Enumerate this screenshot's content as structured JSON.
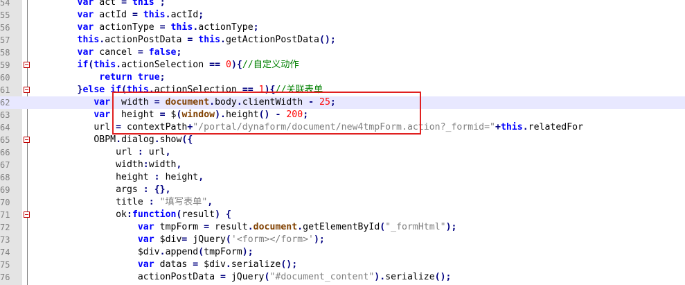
{
  "colors": {
    "keyword": "#0000ff",
    "object": "#804000",
    "string": "#808080",
    "number": "#ff0000",
    "comment": "#008000",
    "current_line": "#e8e8ff",
    "annotation_box": "#e02020"
  },
  "editor": {
    "lines": [
      {
        "num": "54",
        "fold": false,
        "indent": "        ",
        "tokens": [
          {
            "t": "keyword",
            "v": "var"
          },
          {
            "t": "plain",
            "v": " act "
          },
          {
            "t": "op",
            "v": "="
          },
          {
            "t": "plain",
            "v": " "
          },
          {
            "t": "keyword",
            "v": "this"
          },
          {
            "t": "plain",
            "v": " "
          },
          {
            "t": "op",
            "v": ";"
          }
        ]
      },
      {
        "num": "55",
        "fold": false,
        "indent": "        ",
        "tokens": [
          {
            "t": "keyword",
            "v": "var"
          },
          {
            "t": "plain",
            "v": " actId "
          },
          {
            "t": "op",
            "v": "="
          },
          {
            "t": "plain",
            "v": " "
          },
          {
            "t": "keyword",
            "v": "this"
          },
          {
            "t": "op",
            "v": "."
          },
          {
            "t": "plain",
            "v": "actId"
          },
          {
            "t": "op",
            "v": ";"
          }
        ]
      },
      {
        "num": "56",
        "fold": false,
        "indent": "        ",
        "tokens": [
          {
            "t": "keyword",
            "v": "var"
          },
          {
            "t": "plain",
            "v": " actionType "
          },
          {
            "t": "op",
            "v": "="
          },
          {
            "t": "plain",
            "v": " "
          },
          {
            "t": "keyword",
            "v": "this"
          },
          {
            "t": "op",
            "v": "."
          },
          {
            "t": "plain",
            "v": "actionType"
          },
          {
            "t": "op",
            "v": ";"
          }
        ]
      },
      {
        "num": "57",
        "fold": false,
        "indent": "        ",
        "tokens": [
          {
            "t": "keyword",
            "v": "this"
          },
          {
            "t": "op",
            "v": "."
          },
          {
            "t": "plain",
            "v": "actionPostData "
          },
          {
            "t": "op",
            "v": "="
          },
          {
            "t": "plain",
            "v": " "
          },
          {
            "t": "keyword",
            "v": "this"
          },
          {
            "t": "op",
            "v": "."
          },
          {
            "t": "plain",
            "v": "getActionPostData"
          },
          {
            "t": "op",
            "v": "();"
          }
        ]
      },
      {
        "num": "58",
        "fold": false,
        "indent": "        ",
        "tokens": [
          {
            "t": "keyword",
            "v": "var"
          },
          {
            "t": "plain",
            "v": " cancel "
          },
          {
            "t": "op",
            "v": "="
          },
          {
            "t": "plain",
            "v": " "
          },
          {
            "t": "keyword",
            "v": "false"
          },
          {
            "t": "op",
            "v": ";"
          }
        ]
      },
      {
        "num": "59",
        "fold": true,
        "indent": "        ",
        "tokens": [
          {
            "t": "keyword",
            "v": "if"
          },
          {
            "t": "op",
            "v": "("
          },
          {
            "t": "keyword",
            "v": "this"
          },
          {
            "t": "op",
            "v": "."
          },
          {
            "t": "plain",
            "v": "actionSelection "
          },
          {
            "t": "op",
            "v": "=="
          },
          {
            "t": "plain",
            "v": " "
          },
          {
            "t": "number",
            "v": "0"
          },
          {
            "t": "op",
            "v": "){"
          },
          {
            "t": "comment",
            "v": "//自定义动作"
          }
        ]
      },
      {
        "num": "60",
        "fold": false,
        "indent": "            ",
        "tokens": [
          {
            "t": "keyword",
            "v": "return"
          },
          {
            "t": "plain",
            "v": " "
          },
          {
            "t": "keyword",
            "v": "true"
          },
          {
            "t": "op",
            "v": ";"
          }
        ]
      },
      {
        "num": "61",
        "fold": true,
        "indent": "        ",
        "tokens": [
          {
            "t": "op",
            "v": "}"
          },
          {
            "t": "keyword",
            "v": "else"
          },
          {
            "t": "plain",
            "v": " "
          },
          {
            "t": "keyword",
            "v": "if"
          },
          {
            "t": "op",
            "v": "("
          },
          {
            "t": "keyword",
            "v": "this"
          },
          {
            "t": "op",
            "v": "."
          },
          {
            "t": "plain",
            "v": "actionSelection "
          },
          {
            "t": "op",
            "v": "=="
          },
          {
            "t": "plain",
            "v": " "
          },
          {
            "t": "number",
            "v": "1"
          },
          {
            "t": "op",
            "v": "){"
          },
          {
            "t": "comment",
            "v": "//关联表单"
          }
        ]
      },
      {
        "num": "62",
        "fold": false,
        "current": true,
        "indent": "           ",
        "tokens": [
          {
            "t": "keyword",
            "v": "var"
          },
          {
            "t": "plain",
            "v": "  width "
          },
          {
            "t": "op",
            "v": "="
          },
          {
            "t": "plain",
            "v": " "
          },
          {
            "t": "object",
            "v": "document"
          },
          {
            "t": "op",
            "v": "."
          },
          {
            "t": "plain",
            "v": "body"
          },
          {
            "t": "op",
            "v": "."
          },
          {
            "t": "plain",
            "v": "clientWidth "
          },
          {
            "t": "op",
            "v": "-"
          },
          {
            "t": "plain",
            "v": " "
          },
          {
            "t": "number",
            "v": "25"
          },
          {
            "t": "op",
            "v": ";"
          }
        ]
      },
      {
        "num": "63",
        "fold": false,
        "indent": "           ",
        "tokens": [
          {
            "t": "keyword",
            "v": "var"
          },
          {
            "t": "plain",
            "v": "  height "
          },
          {
            "t": "op",
            "v": "="
          },
          {
            "t": "plain",
            "v": " $"
          },
          {
            "t": "op",
            "v": "("
          },
          {
            "t": "object",
            "v": "window"
          },
          {
            "t": "op",
            "v": ")."
          },
          {
            "t": "plain",
            "v": "height"
          },
          {
            "t": "op",
            "v": "()"
          },
          {
            "t": "plain",
            "v": " "
          },
          {
            "t": "op",
            "v": "-"
          },
          {
            "t": "plain",
            "v": " "
          },
          {
            "t": "number",
            "v": "200"
          },
          {
            "t": "op",
            "v": ";"
          }
        ]
      },
      {
        "num": "64",
        "fold": false,
        "indent": "           ",
        "tokens": [
          {
            "t": "plain",
            "v": "url "
          },
          {
            "t": "op",
            "v": "="
          },
          {
            "t": "plain",
            "v": " contextPath"
          },
          {
            "t": "op",
            "v": "+"
          },
          {
            "t": "string",
            "v": "\"/portal/dynaform/document/new4tmpForm.action?_formid=\""
          },
          {
            "t": "op",
            "v": "+"
          },
          {
            "t": "keyword",
            "v": "this"
          },
          {
            "t": "op",
            "v": "."
          },
          {
            "t": "plain",
            "v": "relatedFor"
          }
        ]
      },
      {
        "num": "65",
        "fold": true,
        "indent": "           ",
        "tokens": [
          {
            "t": "plain",
            "v": "OBPM"
          },
          {
            "t": "op",
            "v": "."
          },
          {
            "t": "plain",
            "v": "dialog"
          },
          {
            "t": "op",
            "v": "."
          },
          {
            "t": "plain",
            "v": "show"
          },
          {
            "t": "op",
            "v": "({"
          }
        ]
      },
      {
        "num": "66",
        "fold": false,
        "indent": "               ",
        "tokens": [
          {
            "t": "plain",
            "v": "url "
          },
          {
            "t": "op",
            "v": ":"
          },
          {
            "t": "plain",
            "v": " url"
          },
          {
            "t": "op",
            "v": ","
          }
        ]
      },
      {
        "num": "67",
        "fold": false,
        "indent": "               ",
        "tokens": [
          {
            "t": "plain",
            "v": "width"
          },
          {
            "t": "op",
            "v": ":"
          },
          {
            "t": "plain",
            "v": "width"
          },
          {
            "t": "op",
            "v": ","
          }
        ]
      },
      {
        "num": "68",
        "fold": false,
        "indent": "               ",
        "tokens": [
          {
            "t": "plain",
            "v": "height "
          },
          {
            "t": "op",
            "v": ":"
          },
          {
            "t": "plain",
            "v": " height"
          },
          {
            "t": "op",
            "v": ","
          }
        ]
      },
      {
        "num": "69",
        "fold": false,
        "indent": "               ",
        "tokens": [
          {
            "t": "plain",
            "v": "args "
          },
          {
            "t": "op",
            "v": ":"
          },
          {
            "t": "plain",
            "v": " "
          },
          {
            "t": "op",
            "v": "{},"
          }
        ]
      },
      {
        "num": "70",
        "fold": false,
        "indent": "               ",
        "tokens": [
          {
            "t": "plain",
            "v": "title "
          },
          {
            "t": "op",
            "v": ":"
          },
          {
            "t": "plain",
            "v": " "
          },
          {
            "t": "string",
            "v": "\"填写表单\""
          },
          {
            "t": "op",
            "v": ","
          }
        ]
      },
      {
        "num": "71",
        "fold": true,
        "indent": "               ",
        "tokens": [
          {
            "t": "plain",
            "v": "ok"
          },
          {
            "t": "op",
            "v": ":"
          },
          {
            "t": "keyword",
            "v": "function"
          },
          {
            "t": "op",
            "v": "("
          },
          {
            "t": "plain",
            "v": "result"
          },
          {
            "t": "op",
            "v": ")"
          },
          {
            "t": "plain",
            "v": " "
          },
          {
            "t": "op",
            "v": "{"
          }
        ]
      },
      {
        "num": "72",
        "fold": false,
        "indent": "                   ",
        "tokens": [
          {
            "t": "keyword",
            "v": "var"
          },
          {
            "t": "plain",
            "v": " tmpForm "
          },
          {
            "t": "op",
            "v": "="
          },
          {
            "t": "plain",
            "v": " result"
          },
          {
            "t": "op",
            "v": "."
          },
          {
            "t": "object",
            "v": "document"
          },
          {
            "t": "op",
            "v": "."
          },
          {
            "t": "plain",
            "v": "getElementById"
          },
          {
            "t": "op",
            "v": "("
          },
          {
            "t": "string",
            "v": "\"_formHtml\""
          },
          {
            "t": "op",
            "v": ");"
          }
        ]
      },
      {
        "num": "73",
        "fold": false,
        "indent": "                   ",
        "tokens": [
          {
            "t": "keyword",
            "v": "var"
          },
          {
            "t": "plain",
            "v": " $div"
          },
          {
            "t": "op",
            "v": "="
          },
          {
            "t": "plain",
            "v": " jQuery"
          },
          {
            "t": "op",
            "v": "("
          },
          {
            "t": "string",
            "v": "'<form></form>'"
          },
          {
            "t": "op",
            "v": ");"
          }
        ]
      },
      {
        "num": "74",
        "fold": false,
        "indent": "                   ",
        "tokens": [
          {
            "t": "plain",
            "v": "$div"
          },
          {
            "t": "op",
            "v": "."
          },
          {
            "t": "plain",
            "v": "append"
          },
          {
            "t": "op",
            "v": "("
          },
          {
            "t": "plain",
            "v": "tmpForm"
          },
          {
            "t": "op",
            "v": ");"
          }
        ]
      },
      {
        "num": "75",
        "fold": false,
        "indent": "                   ",
        "tokens": [
          {
            "t": "keyword",
            "v": "var"
          },
          {
            "t": "plain",
            "v": " datas "
          },
          {
            "t": "op",
            "v": "="
          },
          {
            "t": "plain",
            "v": " $div"
          },
          {
            "t": "op",
            "v": "."
          },
          {
            "t": "plain",
            "v": "serialize"
          },
          {
            "t": "op",
            "v": "();"
          }
        ]
      },
      {
        "num": "76",
        "fold": false,
        "indent": "                   ",
        "tokens": [
          {
            "t": "plain",
            "v": "actionPostData "
          },
          {
            "t": "op",
            "v": "="
          },
          {
            "t": "plain",
            "v": " jQuery"
          },
          {
            "t": "op",
            "v": "("
          },
          {
            "t": "string",
            "v": "\"#document_content\""
          },
          {
            "t": "op",
            "v": ")."
          },
          {
            "t": "plain",
            "v": "serialize"
          },
          {
            "t": "op",
            "v": "();"
          }
        ]
      }
    ]
  }
}
